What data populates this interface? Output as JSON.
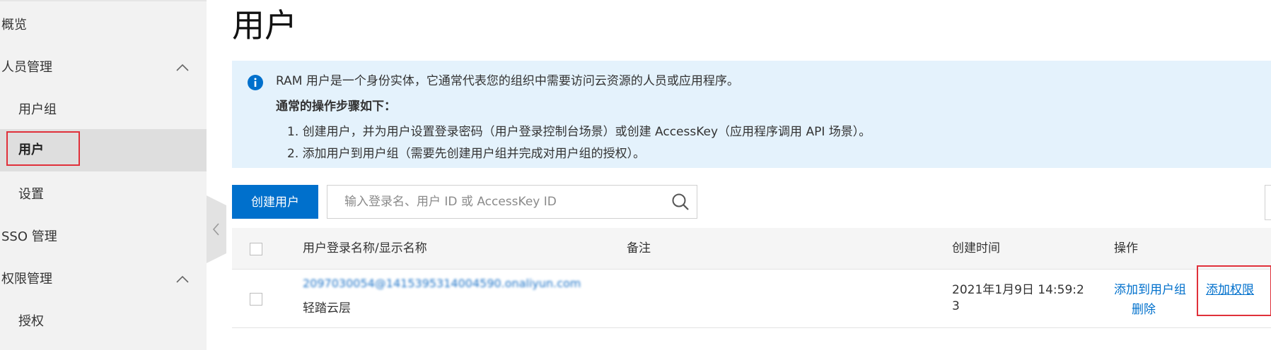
{
  "sidebar": {
    "items": [
      {
        "label": "概览"
      },
      {
        "label": "人员管理"
      },
      {
        "label": "用户组"
      },
      {
        "label": "用户"
      },
      {
        "label": "设置"
      },
      {
        "label": "SSO 管理"
      },
      {
        "label": "权限管理"
      },
      {
        "label": "授权"
      }
    ]
  },
  "page": {
    "title": "用户"
  },
  "info": {
    "line1": "RAM 用户是一个身份实体，它通常代表您的组织中需要访问云资源的人员或应用程序。",
    "heading": "通常的操作步骤如下：",
    "step1": "1. 创建用户，并为用户设置登录密码（用户登录控制台场景）或创建 AccessKey（应用程序调用 API 场景）。",
    "step2": "2. 添加用户到用户组（需要先创建用户组并完成对用户组的授权）。"
  },
  "toolbar": {
    "create_label": "创建用户",
    "search_placeholder": "输入登录名、用户 ID 或 AccessKey ID"
  },
  "table": {
    "columns": [
      "用户登录名称/显示名称",
      "备注",
      "创建时间",
      "操作"
    ],
    "rows": [
      {
        "login_name": "2097030054@1415395314004590.onaliyun.com",
        "display_name": "轻踏云层",
        "note": "",
        "created_line1": "2021年1月9日 14:59:2",
        "created_line2": "3",
        "actions": {
          "add_to_group": "添加到用户组",
          "add_permission": "添加权限",
          "delete": "删除"
        }
      }
    ]
  },
  "colors": {
    "primary": "#0070cc",
    "info_bg": "#e4f2fc",
    "highlight": "#e0303a",
    "sidebar_bg": "#f2f2f2"
  }
}
